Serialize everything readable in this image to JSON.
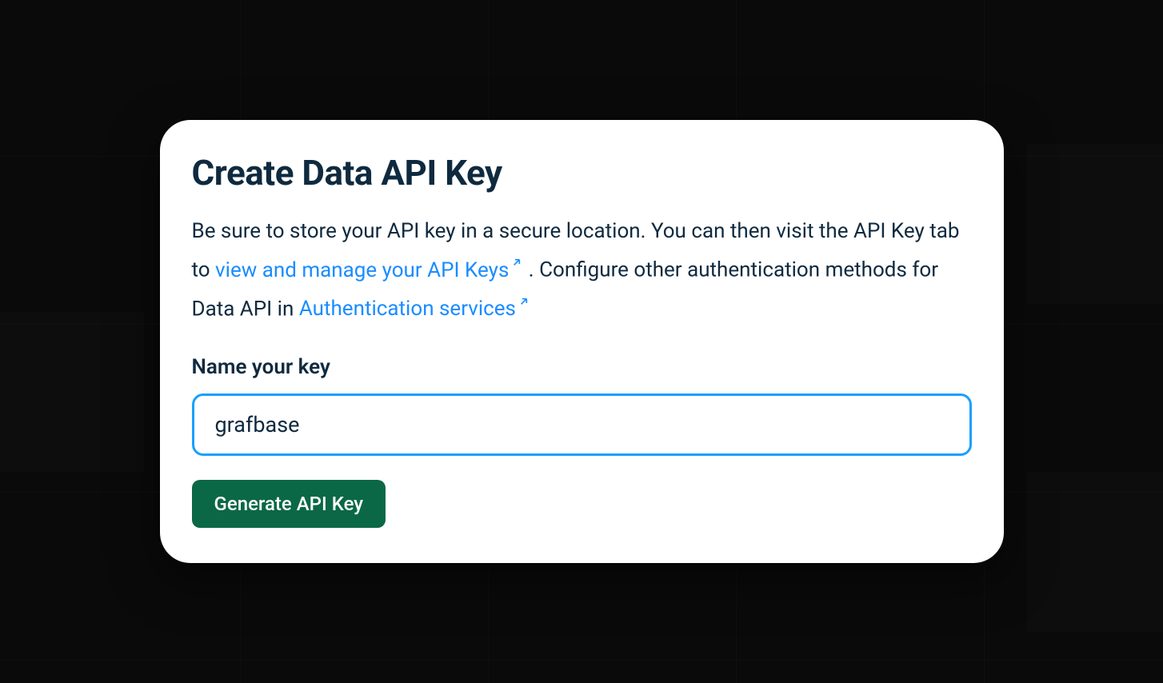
{
  "card": {
    "title": "Create Data API Key",
    "description_parts": {
      "text1": "Be sure to store your API key in a secure location. You can then visit the API Key tab to ",
      "link1": "view and manage your API Keys",
      "text2": " . Configure other authentication methods for Data API in ",
      "link2": "Authentication services"
    },
    "field_label": "Name your key",
    "input_value": "grafbase",
    "button_label": "Generate API Key"
  }
}
